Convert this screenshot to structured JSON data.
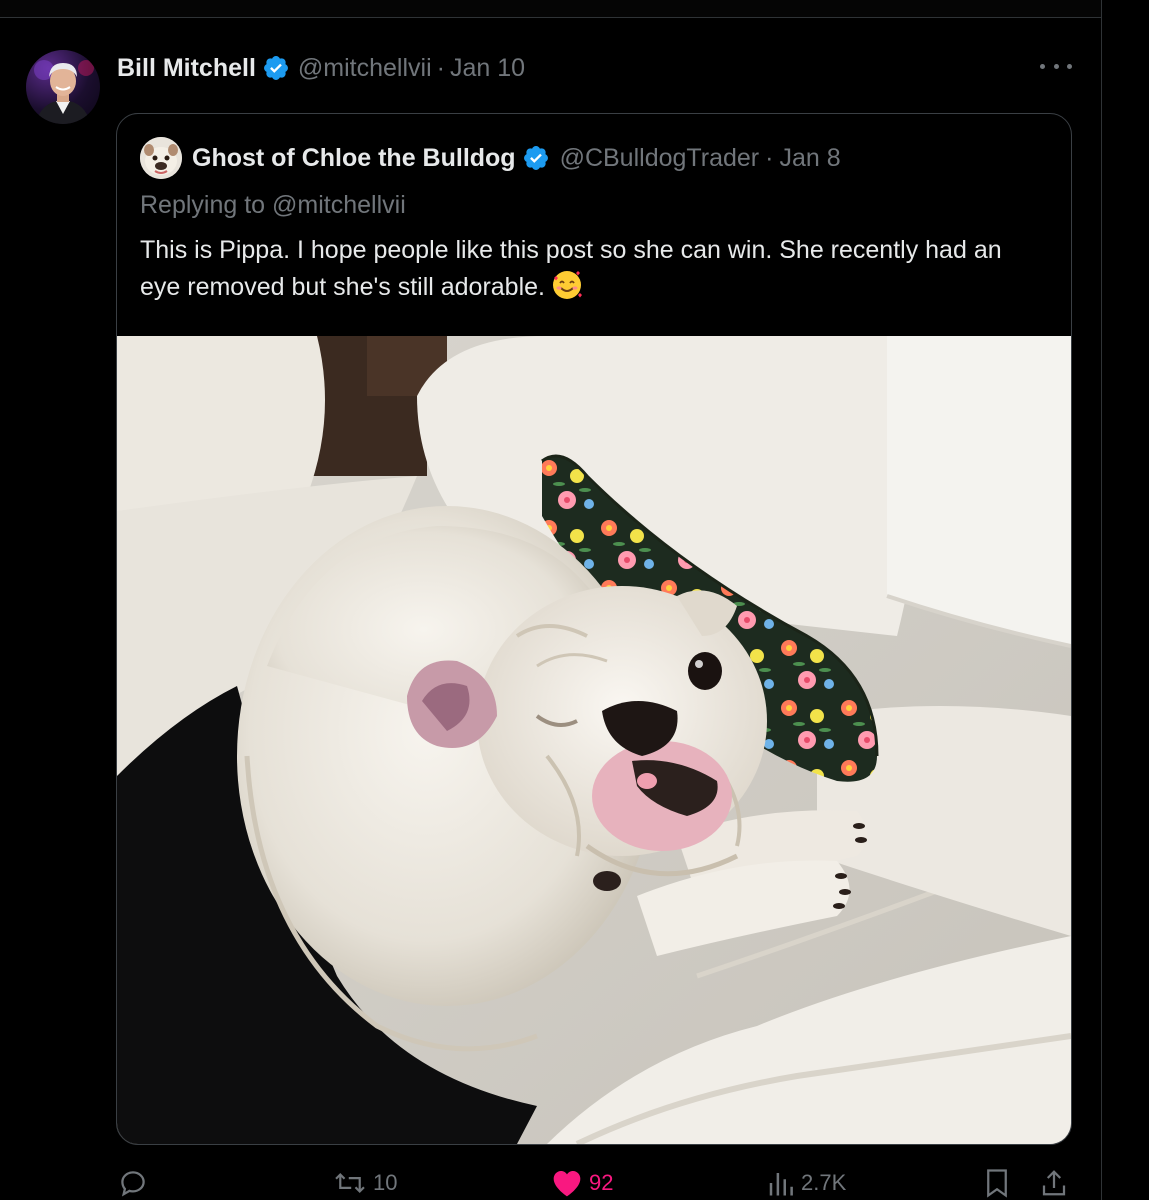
{
  "post": {
    "author_name": "Bill Mitchell",
    "author_handle": "@mitchellvii",
    "separator": "·",
    "date": "Jan 10",
    "more_icon": "more-horizontal-icon"
  },
  "quoted": {
    "author_name": "Ghost of Chloe the Bulldog",
    "author_handle": "@CBulldogTrader",
    "separator": "·",
    "date": "Jan 8",
    "replying_prefix": "Replying to ",
    "replying_handle": "@mitchellvii",
    "text": "This is Pippa. I hope people like this post so she can win. She recently had an eye removed but she's still adorable.",
    "emoji": "smiling-face-with-hearts",
    "media_description_icon": "photo-of-white-bulldog"
  },
  "actions": {
    "reply_icon": "reply-icon",
    "retweets": "10",
    "likes": "92",
    "views": "2.7K",
    "bookmark_icon": "bookmark-icon",
    "share_icon": "share-icon"
  },
  "colors": {
    "background": "#000000",
    "text": "#e7e9ea",
    "muted": "#71767b",
    "verified_blue": "#1d9bf0",
    "like_pink": "#f91880",
    "border": "#2f3336"
  }
}
